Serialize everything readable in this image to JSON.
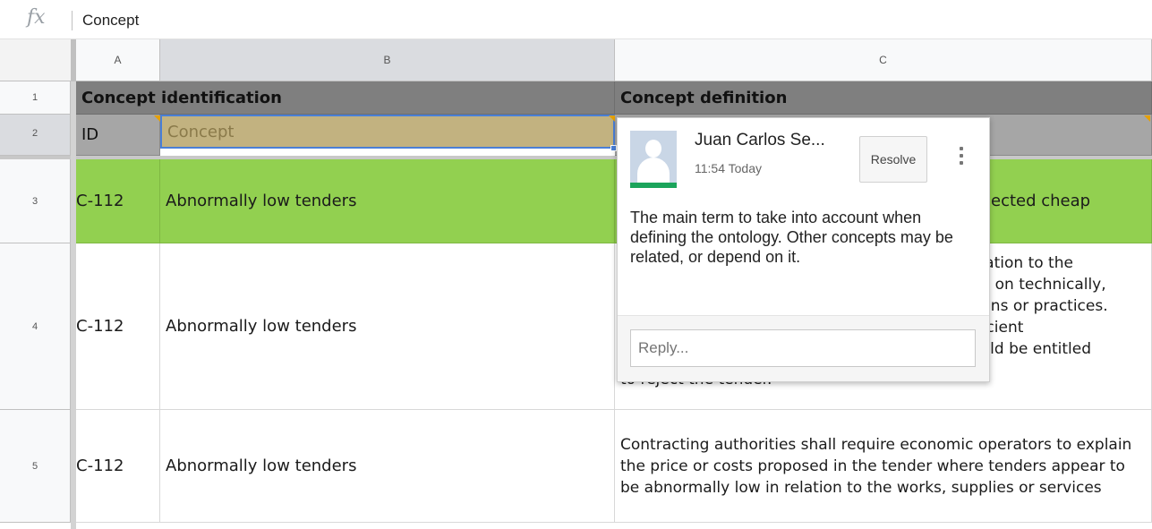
{
  "formula_bar": {
    "fx_label": "fx",
    "value": "Concept"
  },
  "columns": [
    "A",
    "B",
    "C"
  ],
  "rows": [
    "1",
    "2",
    "3",
    "4",
    "5"
  ],
  "row1": {
    "identification": "Concept identification",
    "definition": "Concept definition"
  },
  "row2": {
    "id": "ID",
    "concept": "Concept"
  },
  "row3": {
    "id": "C-112",
    "concept": "Abnormally low tenders",
    "definition": "ected cheap"
  },
  "row4": {
    "id": "C-112",
    "concept": "Abnormally low tenders",
    "definition_lines": [
      "elation to the",
      "ed on technically,",
      "tions or practices.",
      "fficient",
      "ould be entitled",
      "to reject the tender."
    ]
  },
  "row5": {
    "id": "C-112",
    "concept": "Abnormally low tenders",
    "definition": "Contracting authorities shall require economic operators to explain the price or costs proposed in the tender where tenders appear to be abnormally low in relation to the works, supplies or services"
  },
  "comment": {
    "author": "Juan Carlos Se...",
    "time": "11:54 Today",
    "resolve_label": "Resolve",
    "body": "The main term to take into account when defining the ontology. Other concepts may be related, or depend on it.",
    "reply_placeholder": "Reply..."
  },
  "colors": {
    "header_dark": "#7f7f7f",
    "header_light": "#a6a6a6",
    "green_row": "#92d050",
    "selected_cell": "#c2b280",
    "selection_blue": "#4a7fd6",
    "avatar_status": "#1ba45b"
  }
}
